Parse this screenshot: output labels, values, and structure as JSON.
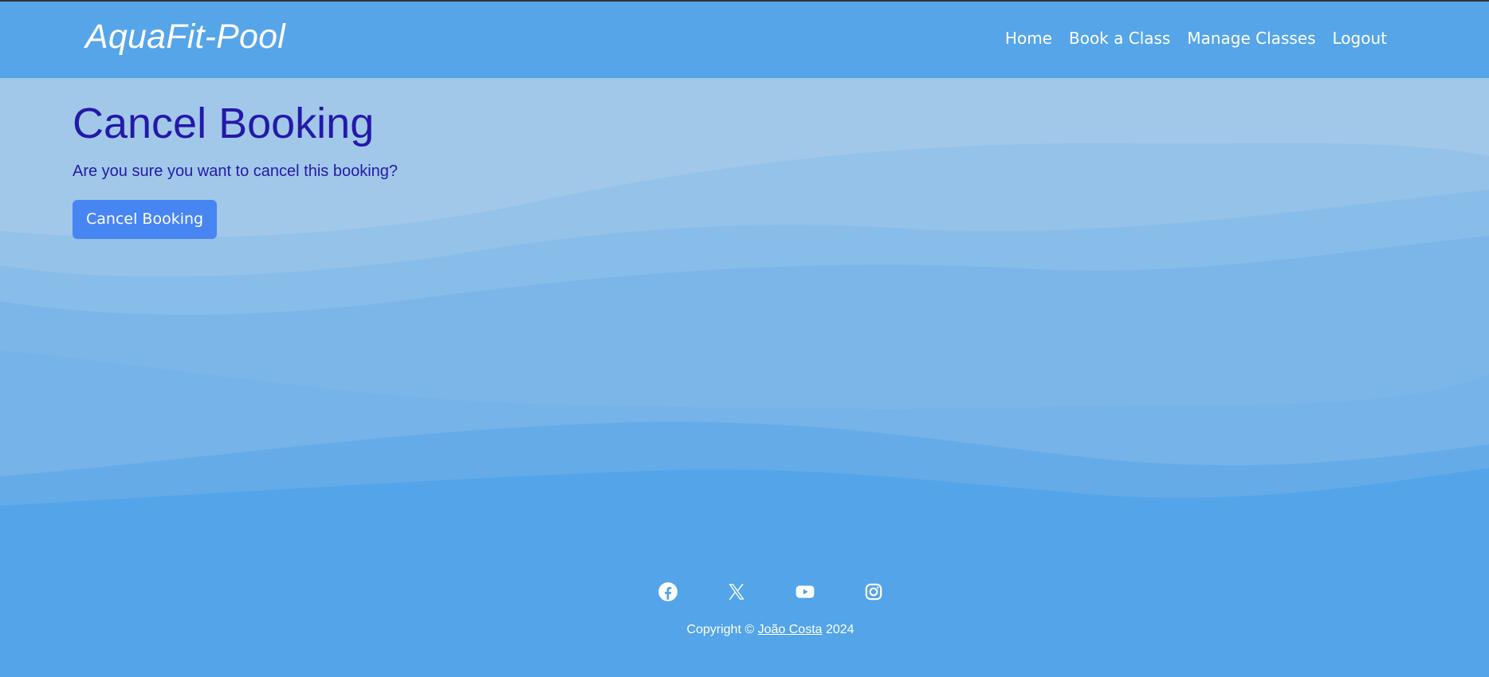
{
  "navbar": {
    "brand": "AquaFit-Pool",
    "links": [
      "Home",
      "Book a Class",
      "Manage Classes",
      "Logout"
    ]
  },
  "main": {
    "title": "Cancel Booking",
    "prompt": "Are you sure you want to cancel this booking?",
    "button_label": "Cancel Booking"
  },
  "footer": {
    "social_icons": [
      "facebook-icon",
      "x-icon",
      "youtube-icon",
      "instagram-icon"
    ],
    "copyright_prefix": "Copyright ©",
    "author": "João Costa",
    "year": "2024"
  },
  "colors": {
    "navbar": "#56a5e8",
    "heading": "#2419a8",
    "button": "#4785f2",
    "wave_light": "#a1c8e9",
    "wave_mid": "#7cb6e9",
    "wave_deep": "#53a4e8"
  }
}
